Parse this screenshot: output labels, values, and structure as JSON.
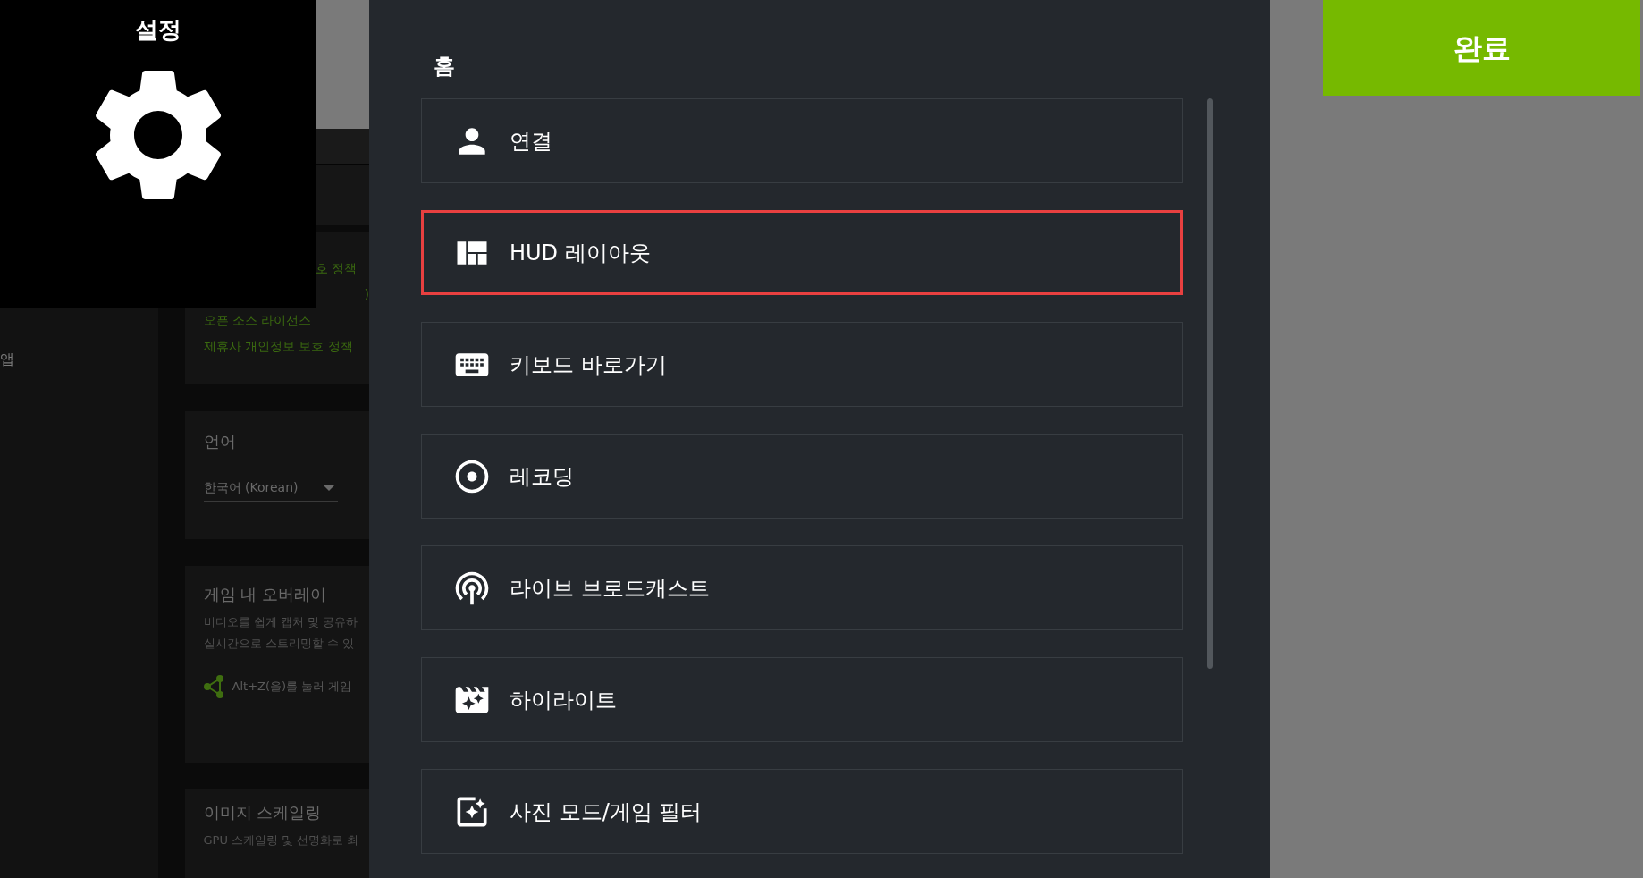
{
  "settings_badge": {
    "title": "설정"
  },
  "background": {
    "side_label": "앱",
    "links": [
      "호 정책",
      ")",
      "오픈 소스 라이선스",
      "제휴사 개인정보 보호 정책"
    ],
    "language": {
      "title": "언어",
      "value": "한국어 (Korean)"
    },
    "overlay": {
      "title": "게임 내 오버레이",
      "description": [
        "비디오를 쉽게 캡처 및 공유하",
        "실시간으로 스트리밍할 수 있"
      ],
      "hint": "Alt+Z(을)를 눌러 게임"
    },
    "scaling": {
      "title": "이미지 스케일링",
      "description": "GPU 스케일링 및 선명화로 최"
    }
  },
  "panel": {
    "title": "홈",
    "items": [
      {
        "label": "연결",
        "selected": false
      },
      {
        "label": "HUD 레이아웃",
        "selected": true
      },
      {
        "label": "키보드 바로가기",
        "selected": false
      },
      {
        "label": "레코딩",
        "selected": false
      },
      {
        "label": "라이브 브로드캐스트",
        "selected": false
      },
      {
        "label": "하이라이트",
        "selected": false
      },
      {
        "label": "사진 모드/게임 필터",
        "selected": false
      }
    ]
  },
  "done_button": "완료"
}
